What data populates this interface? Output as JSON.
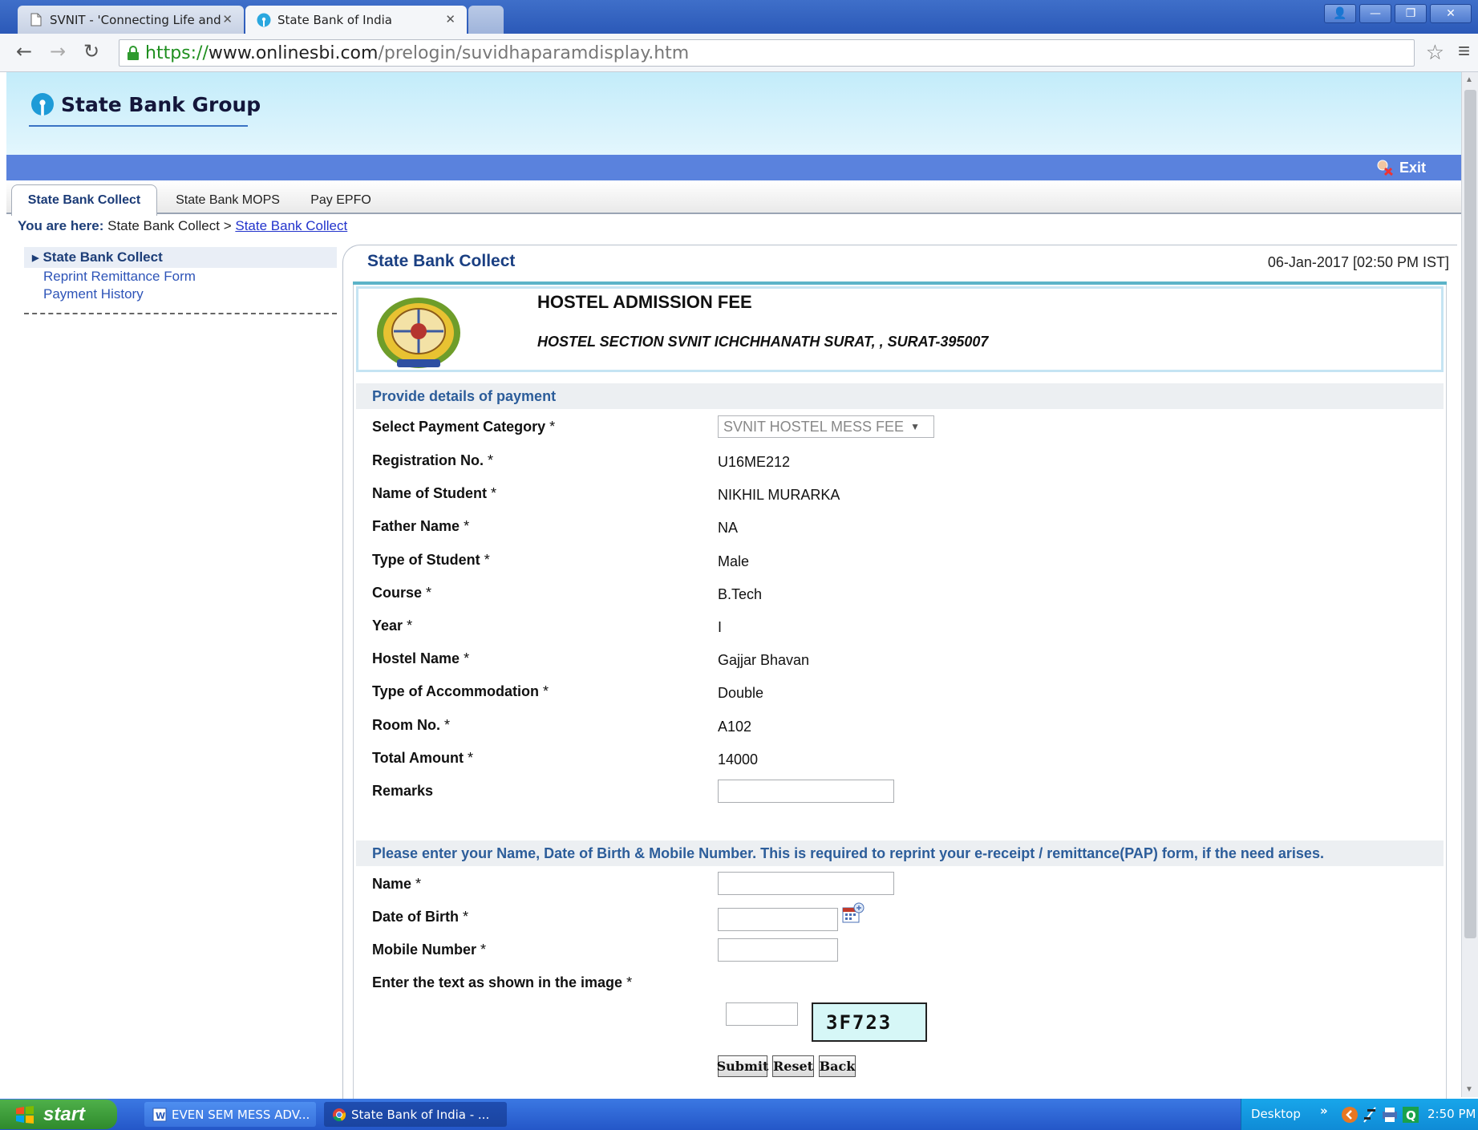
{
  "browser": {
    "tabs": [
      {
        "title": "SVNIT - 'Connecting Life and"
      },
      {
        "title": "State Bank of India"
      }
    ],
    "url": {
      "scheme": "https://",
      "host": "www.onlinesbi.com",
      "path": "/prelogin/suvidhaparamdisplay.htm"
    }
  },
  "header": {
    "logo_text": "State Bank Group",
    "exit_label": "Exit"
  },
  "app_tabs": [
    {
      "label": "State Bank Collect"
    },
    {
      "label": "State Bank MOPS"
    },
    {
      "label": "Pay EPFO"
    }
  ],
  "breadcrumb": {
    "prefix": "You are here:",
    "part1": "State Bank Collect >",
    "link": "State Bank Collect"
  },
  "left_nav": {
    "current": "State Bank Collect",
    "links": [
      "Reprint Remittance Form",
      "Payment History"
    ]
  },
  "main": {
    "title": "State Bank Collect",
    "datetime": "06-Jan-2017 [02:50 PM IST]",
    "institution": {
      "name": "HOSTEL ADMISSION FEE",
      "address": "HOSTEL SECTION SVNIT ICHCHHANATH SURAT, , SURAT-395007"
    },
    "payment_section": {
      "heading": "Provide details of payment",
      "category_label": "Select Payment Category",
      "category_value": "SVNIT HOSTEL MESS FEE",
      "fields": [
        {
          "label": "Registration No.",
          "value": "U16ME212"
        },
        {
          "label": "Name of Student",
          "value": "NIKHIL MURARKA"
        },
        {
          "label": "Father Name",
          "value": "NA"
        },
        {
          "label": "Type of Student",
          "value": "Male"
        },
        {
          "label": "Course",
          "value": "B.Tech"
        },
        {
          "label": "Year",
          "value": "I"
        },
        {
          "label": "Hostel Name",
          "value": "Gajjar Bhavan"
        },
        {
          "label": "Type of Accommodation",
          "value": "Double"
        },
        {
          "label": "Room No.",
          "value": "A102"
        },
        {
          "label": "Total Amount",
          "value": "14000"
        }
      ],
      "remarks_label": "Remarks",
      "remarks_value": ""
    },
    "personal_section": {
      "heading": "Please enter your Name, Date of Birth & Mobile Number. This is required to reprint your e-receipt / remittance(PAP) form, if the need arises.",
      "name_label": "Name",
      "dob_label": "Date of Birth",
      "mobile_label": "Mobile Number",
      "captcha_label": "Enter the text as shown in the image",
      "captcha_text": "3F723",
      "required_mark": "*"
    },
    "buttons": {
      "submit": "Submit",
      "reset": "Reset",
      "back": "Back"
    }
  },
  "taskbar": {
    "start_label": "start",
    "items": [
      {
        "label": "EVEN SEM MESS ADV..."
      },
      {
        "label": "State Bank of India - ..."
      }
    ],
    "desktop_label": "Desktop",
    "clock": "2:50 PM"
  },
  "colors": {
    "accent_blue": "#5a82dd",
    "header_cyan": "#c3ecfa",
    "title_blue": "#1a3f82",
    "section_text": "#2c5d9a"
  }
}
